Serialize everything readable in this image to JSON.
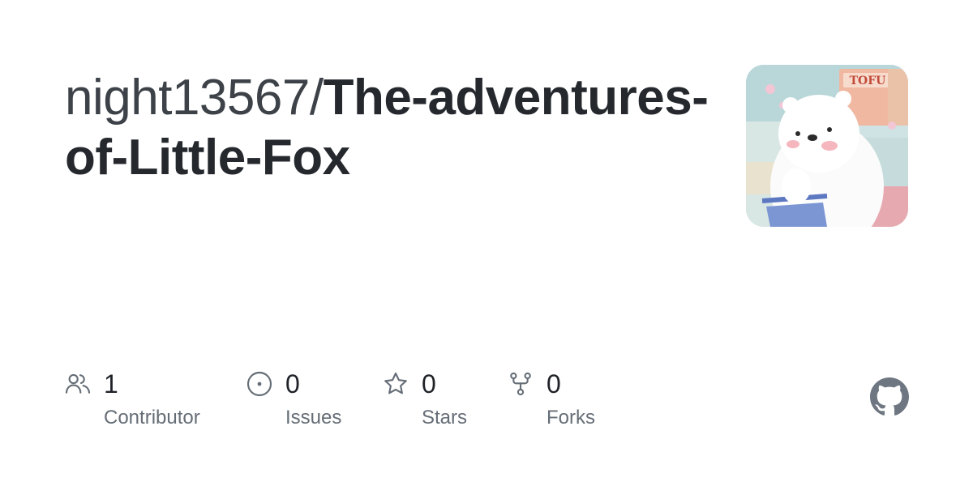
{
  "repo": {
    "owner": "night13567/",
    "name": "The-adventures-of-Little-Fox"
  },
  "avatar": {
    "icon": "repo-owner-avatar",
    "text": "TOFU"
  },
  "stats": [
    {
      "icon": "people-icon",
      "count": "1",
      "label": "Contributor"
    },
    {
      "icon": "issue-opened-icon",
      "count": "0",
      "label": "Issues"
    },
    {
      "icon": "star-icon",
      "count": "0",
      "label": "Stars"
    },
    {
      "icon": "fork-icon",
      "count": "0",
      "label": "Forks"
    }
  ],
  "brand": {
    "icon": "github-logo-icon",
    "color": "#6e7781"
  },
  "colors": {
    "title": "#1f2328",
    "muted": "#656d76",
    "icon": "#656d76"
  }
}
